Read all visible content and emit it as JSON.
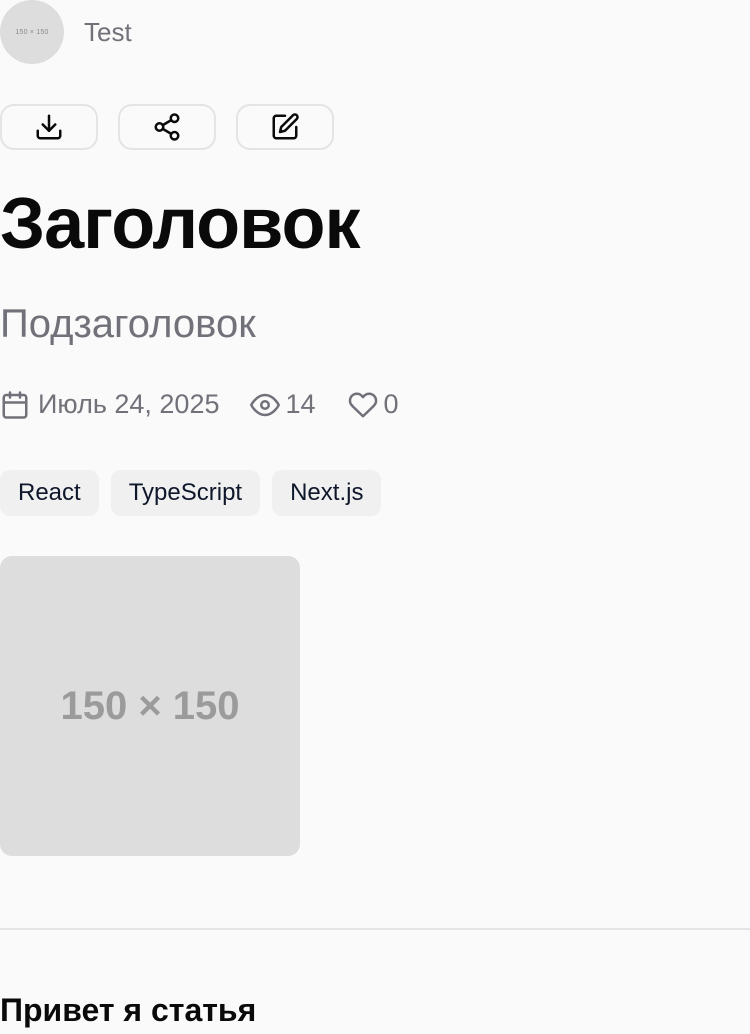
{
  "author": {
    "avatar_placeholder": "150 × 150",
    "name": "Test"
  },
  "actions": {
    "download_icon": "download-icon",
    "share_icon": "share-icon",
    "edit_icon": "edit-icon"
  },
  "article": {
    "title": "Заголовок",
    "subtitle": "Подзаголовок",
    "date": "Июль 24, 2025",
    "views": "14",
    "likes": "0",
    "tags": [
      "React",
      "TypeScript",
      "Next.js"
    ],
    "cover_placeholder": "150 × 150",
    "content_heading": "Привет я статья"
  },
  "colors": {
    "background": "#fafafa",
    "text": "#0a0a0a",
    "muted": "#71717a",
    "border": "#e4e4e7",
    "tag_bg": "#f0f0f1",
    "placeholder_bg": "#dddddd"
  }
}
